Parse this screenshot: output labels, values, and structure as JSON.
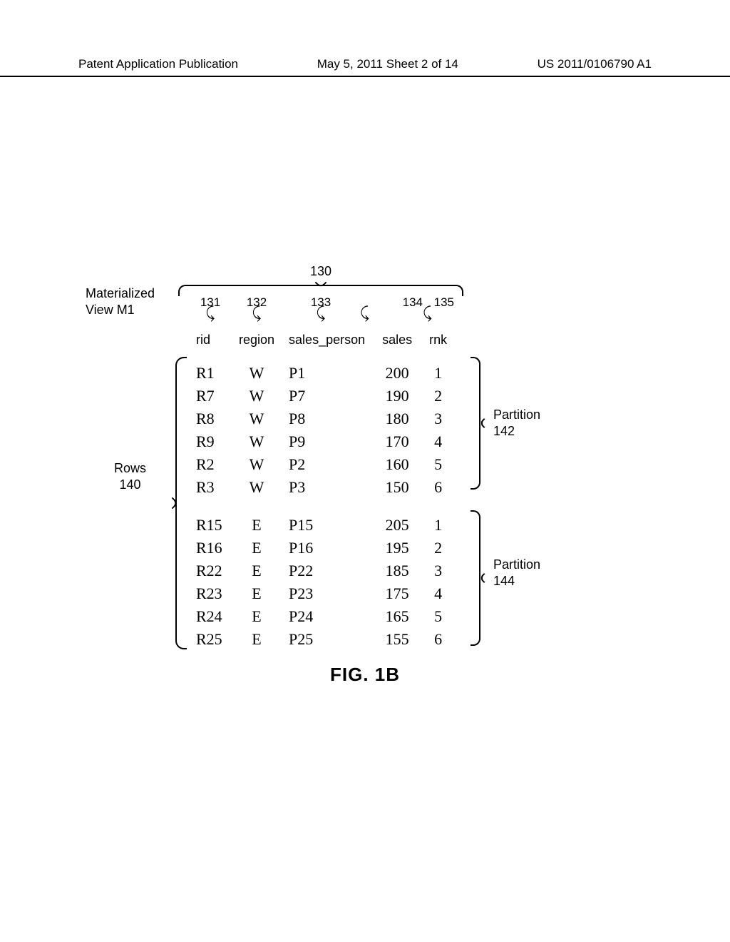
{
  "header": {
    "left": "Patent Application Publication",
    "center": "May 5, 2011  Sheet 2 of 14",
    "right": "US 2011/0106790 A1"
  },
  "labels": {
    "mv_line1": "Materialized",
    "mv_line2": "View M1",
    "rows_line1": "Rows",
    "rows_line2": "140",
    "partition1_line1": "Partition",
    "partition1_line2": "142",
    "partition2_line1": "Partition",
    "partition2_line2": "144",
    "top_ref": "130",
    "col_refs": {
      "r1": "131",
      "r2": "132",
      "r3": "133",
      "r4": "134",
      "r5": "135"
    }
  },
  "columns": {
    "c1": "rid",
    "c2": "region",
    "c3": "sales_person",
    "c4": "sales",
    "c5": "rnk"
  },
  "rows_p1": [
    {
      "rid": "R1",
      "region": "W",
      "sp": "P1",
      "sales": "200",
      "rnk": "1"
    },
    {
      "rid": "R7",
      "region": "W",
      "sp": "P7",
      "sales": "190",
      "rnk": "2"
    },
    {
      "rid": "R8",
      "region": "W",
      "sp": "P8",
      "sales": "180",
      "rnk": "3"
    },
    {
      "rid": "R9",
      "region": "W",
      "sp": "P9",
      "sales": "170",
      "rnk": "4"
    },
    {
      "rid": "R2",
      "region": "W",
      "sp": "P2",
      "sales": "160",
      "rnk": "5"
    },
    {
      "rid": "R3",
      "region": "W",
      "sp": "P3",
      "sales": "150",
      "rnk": "6"
    }
  ],
  "rows_p2": [
    {
      "rid": "R15",
      "region": "E",
      "sp": "P15",
      "sales": "205",
      "rnk": "1"
    },
    {
      "rid": "R16",
      "region": "E",
      "sp": "P16",
      "sales": "195",
      "rnk": "2"
    },
    {
      "rid": "R22",
      "region": "E",
      "sp": "P22",
      "sales": "185",
      "rnk": "3"
    },
    {
      "rid": "R23",
      "region": "E",
      "sp": "P23",
      "sales": "175",
      "rnk": "4"
    },
    {
      "rid": "R24",
      "region": "E",
      "sp": "P24",
      "sales": "165",
      "rnk": "5"
    },
    {
      "rid": "R25",
      "region": "E",
      "sp": "P25",
      "sales": "155",
      "rnk": "6"
    }
  ],
  "caption": "FIG. 1B",
  "chart_data": {
    "type": "table",
    "title": "Materialized View M1",
    "columns": [
      "rid",
      "region",
      "sales_person",
      "sales",
      "rnk"
    ],
    "partitions": [
      {
        "name": "Partition 142",
        "region": "W",
        "rows": [
          {
            "rid": "R1",
            "region": "W",
            "sales_person": "P1",
            "sales": 200,
            "rnk": 1
          },
          {
            "rid": "R7",
            "region": "W",
            "sales_person": "P7",
            "sales": 190,
            "rnk": 2
          },
          {
            "rid": "R8",
            "region": "W",
            "sales_person": "P8",
            "sales": 180,
            "rnk": 3
          },
          {
            "rid": "R9",
            "region": "W",
            "sales_person": "P9",
            "sales": 170,
            "rnk": 4
          },
          {
            "rid": "R2",
            "region": "W",
            "sales_person": "P2",
            "sales": 160,
            "rnk": 5
          },
          {
            "rid": "R3",
            "region": "W",
            "sales_person": "P3",
            "sales": 150,
            "rnk": 6
          }
        ]
      },
      {
        "name": "Partition 144",
        "region": "E",
        "rows": [
          {
            "rid": "R15",
            "region": "E",
            "sales_person": "P15",
            "sales": 205,
            "rnk": 1
          },
          {
            "rid": "R16",
            "region": "E",
            "sales_person": "P16",
            "sales": 195,
            "rnk": 2
          },
          {
            "rid": "R22",
            "region": "E",
            "sales_person": "P22",
            "sales": 185,
            "rnk": 3
          },
          {
            "rid": "R23",
            "region": "E",
            "sales_person": "P23",
            "sales": 175,
            "rnk": 4
          },
          {
            "rid": "R24",
            "region": "E",
            "sales_person": "P24",
            "sales": 165,
            "rnk": 5
          },
          {
            "rid": "R25",
            "region": "E",
            "sales_person": "P25",
            "sales": 155,
            "rnk": 6
          }
        ]
      }
    ]
  }
}
